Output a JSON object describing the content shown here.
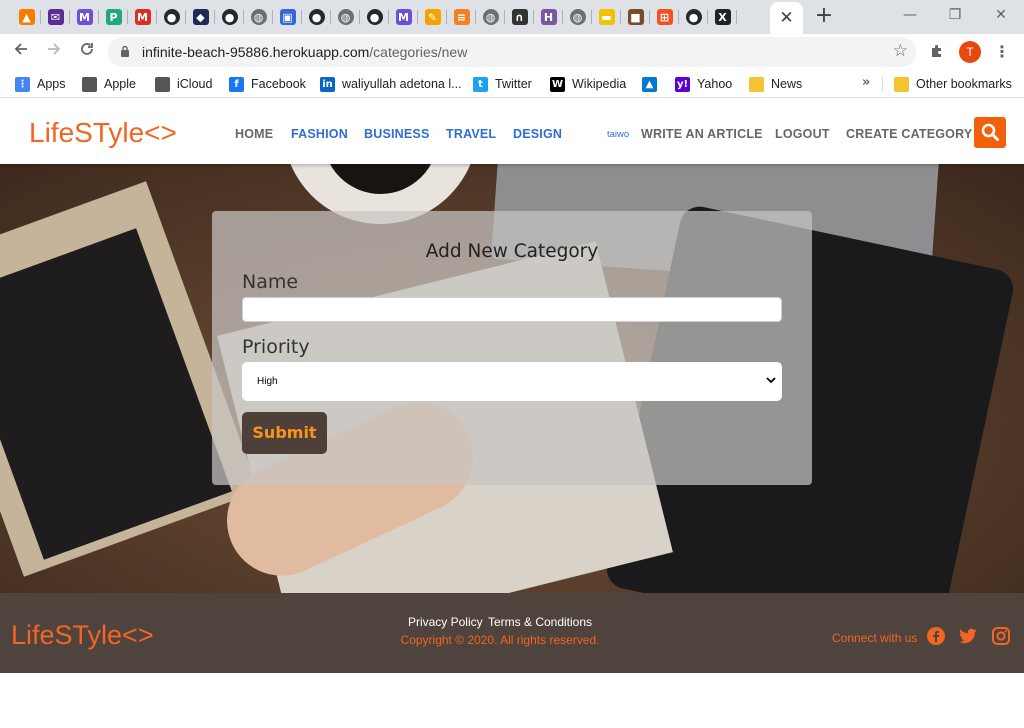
{
  "browser": {
    "tab_favicons": [
      {
        "name": "analytics-favicon",
        "glyph": "▲",
        "color": "#f57c00"
      },
      {
        "name": "mail-favicon",
        "glyph": "✉",
        "color": "#5c2d91"
      },
      {
        "name": "microverse-favicon",
        "glyph": "M",
        "color": "#6f4fd8"
      },
      {
        "name": "medium-favicon",
        "glyph": "P",
        "color": "#1fa97a"
      },
      {
        "name": "gmail-favicon",
        "glyph": "M",
        "color": "#d93025"
      },
      {
        "name": "github-favicon",
        "glyph": "●",
        "color": "#24292e"
      },
      {
        "name": "devto-favicon",
        "glyph": "◆",
        "color": "#1d2c57"
      },
      {
        "name": "github-favicon",
        "glyph": "●",
        "color": "#24292e"
      },
      {
        "name": "globe-favicon",
        "glyph": "◍",
        "color": "#6b6f74"
      },
      {
        "name": "bank-favicon",
        "glyph": "▣",
        "color": "#3367d6"
      },
      {
        "name": "github-favicon",
        "glyph": "●",
        "color": "#24292e"
      },
      {
        "name": "globe-favicon",
        "glyph": "◍",
        "color": "#6b6f74"
      },
      {
        "name": "github-favicon",
        "glyph": "●",
        "color": "#24292e"
      },
      {
        "name": "microverse-favicon",
        "glyph": "M",
        "color": "#6f4fd8"
      },
      {
        "name": "pencil-favicon",
        "glyph": "✎",
        "color": "#f2a300"
      },
      {
        "name": "stackoverflow-favicon",
        "glyph": "≡",
        "color": "#f48024"
      },
      {
        "name": "globe-favicon",
        "glyph": "◍",
        "color": "#6b6f74"
      },
      {
        "name": "arch-favicon",
        "glyph": "∩",
        "color": "#333333"
      },
      {
        "name": "heroku-favicon",
        "glyph": "H",
        "color": "#79589f"
      },
      {
        "name": "globe-favicon",
        "glyph": "◍",
        "color": "#6b6f74"
      },
      {
        "name": "bank-card-favicon",
        "glyph": "▬",
        "color": "#f2c200"
      },
      {
        "name": "box-favicon",
        "glyph": "■",
        "color": "#7a4b2a"
      },
      {
        "name": "microsoft-favicon",
        "glyph": "⊞",
        "color": "#f25022"
      },
      {
        "name": "github-favicon",
        "glyph": "●",
        "color": "#24292e"
      },
      {
        "name": "x-favicon",
        "glyph": "X",
        "color": "#222222"
      }
    ],
    "close_tab_label": "✕",
    "new_tab_label": "+",
    "minimize_label": "—",
    "restore_label": "❐",
    "close_window_label": "✕",
    "url_host": "infinite-beach-95886.herokuapp.com",
    "url_path": "/categories/new",
    "profile_initial": "T",
    "bookmarks": [
      {
        "name": "bookmark-apps",
        "label": "Apps",
        "icon": "apps-grid-icon",
        "color": "#4285f4",
        "glyph": "⋮"
      },
      {
        "name": "bookmark-apple",
        "label": "Apple",
        "icon": "apple-icon",
        "color": "#555555",
        "glyph": ""
      },
      {
        "name": "bookmark-icloud",
        "label": "iCloud",
        "icon": "apple-icon",
        "color": "#555555",
        "glyph": ""
      },
      {
        "name": "bookmark-facebook",
        "label": "Facebook",
        "icon": "facebook-icon",
        "color": "#1877f2",
        "glyph": "f"
      },
      {
        "name": "bookmark-linkedin",
        "label": "waliyullah adetona l...",
        "icon": "linkedin-icon",
        "color": "#0a66c2",
        "glyph": "in"
      },
      {
        "name": "bookmark-twitter",
        "label": "Twitter",
        "icon": "twitter-icon",
        "color": "#1da1f2",
        "glyph": "t"
      },
      {
        "name": "bookmark-wikipedia",
        "label": "Wikipedia",
        "icon": "wikipedia-icon",
        "color": "#000000",
        "glyph": "W"
      },
      {
        "name": "bookmark-azure",
        "label": "",
        "icon": "azure-icon",
        "color": "#0078d4",
        "glyph": "▲"
      },
      {
        "name": "bookmark-yahoo",
        "label": "Yahoo",
        "icon": "yahoo-icon",
        "color": "#6001d2",
        "glyph": "y!"
      },
      {
        "name": "bookmark-news",
        "label": "News",
        "icon": "folder-icon",
        "color": "#f4c430",
        "glyph": ""
      }
    ],
    "more_bookmarks_label": "»",
    "other_bookmarks_label": "Other bookmarks"
  },
  "header": {
    "logo": "LifeSTyle<>",
    "nav_left": [
      {
        "name": "nav-home",
        "label": "HOME",
        "style": "dark"
      },
      {
        "name": "nav-fashion",
        "label": "FASHION",
        "style": "blue"
      },
      {
        "name": "nav-business",
        "label": "BUSINESS",
        "style": "blue"
      },
      {
        "name": "nav-travel",
        "label": "TRAVEL",
        "style": "blue"
      },
      {
        "name": "nav-design",
        "label": "DESIGN",
        "style": "blue"
      }
    ],
    "username": "taiwo",
    "nav_right": [
      {
        "name": "nav-write-article",
        "label": "WRITE AN ARTICLE"
      },
      {
        "name": "nav-logout",
        "label": "LOGOUT"
      },
      {
        "name": "nav-create-category",
        "label": "CREATE CATEGORY"
      }
    ],
    "accent_color": "#f26522"
  },
  "form": {
    "title": "Add New Category",
    "name_label": "Name",
    "name_value": "",
    "priority_label": "Priority",
    "priority_selected": "High",
    "submit_label": "Submit"
  },
  "footer": {
    "logo": "LifeSTyle<>",
    "privacy_link": "Privacy Policy",
    "terms_link": "Terms & Conditions",
    "copyright": "Copyright © 2020. All rights reserved.",
    "connect_label": "Connect with us",
    "social": [
      "facebook-icon",
      "twitter-icon",
      "instagram-icon"
    ]
  }
}
